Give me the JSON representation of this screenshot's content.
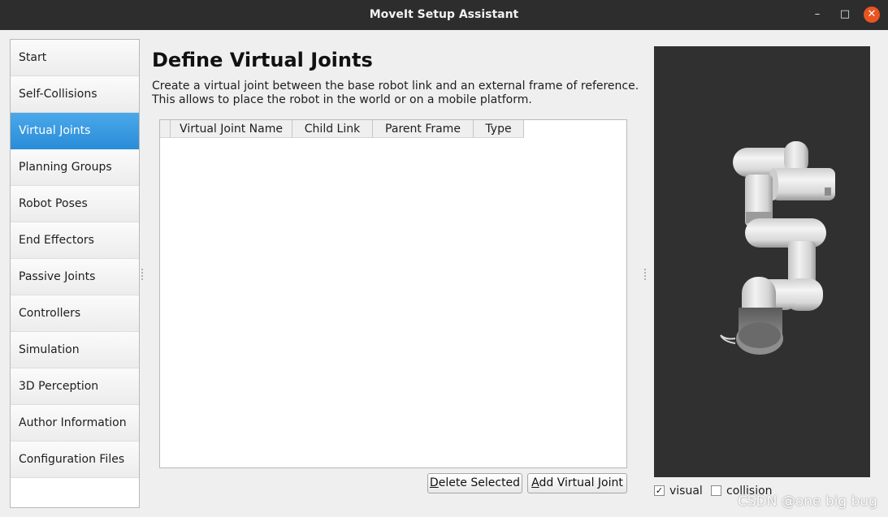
{
  "window": {
    "title": "MoveIt Setup Assistant"
  },
  "window_controls": {
    "minimize": "–",
    "maximize": "□",
    "close": "✕"
  },
  "sidebar": {
    "items": [
      {
        "label": "Start",
        "active": false
      },
      {
        "label": "Self-Collisions",
        "active": false
      },
      {
        "label": "Virtual Joints",
        "active": true
      },
      {
        "label": "Planning Groups",
        "active": false
      },
      {
        "label": "Robot Poses",
        "active": false
      },
      {
        "label": "End Effectors",
        "active": false
      },
      {
        "label": "Passive Joints",
        "active": false
      },
      {
        "label": "Controllers",
        "active": false
      },
      {
        "label": "Simulation",
        "active": false
      },
      {
        "label": "3D Perception",
        "active": false
      },
      {
        "label": "Author Information",
        "active": false
      },
      {
        "label": "Configuration Files",
        "active": false
      }
    ]
  },
  "main": {
    "title": "Define Virtual Joints",
    "description_line1": "Create a virtual joint between the base robot link and an external frame of reference.",
    "description_line2": "This allows to place the robot in the world or on a mobile platform.",
    "table": {
      "columns": [
        "Virtual Joint Name",
        "Child Link",
        "Parent Frame",
        "Type"
      ],
      "rows": []
    },
    "buttons": {
      "delete": {
        "mnemonic": "D",
        "rest": "elete Selected"
      },
      "add": {
        "mnemonic": "A",
        "rest": "dd Virtual Joint"
      }
    }
  },
  "viewer": {
    "background": "#303030",
    "visual_label": "visual",
    "visual_checked": true,
    "collision_label": "collision",
    "collision_checked": false,
    "check_glyph": "✓"
  },
  "watermark": "CSDN @one big bug",
  "colors": {
    "accent": "#2a8dd8",
    "close": "#e95420",
    "titlebar": "#2d2d2d"
  }
}
